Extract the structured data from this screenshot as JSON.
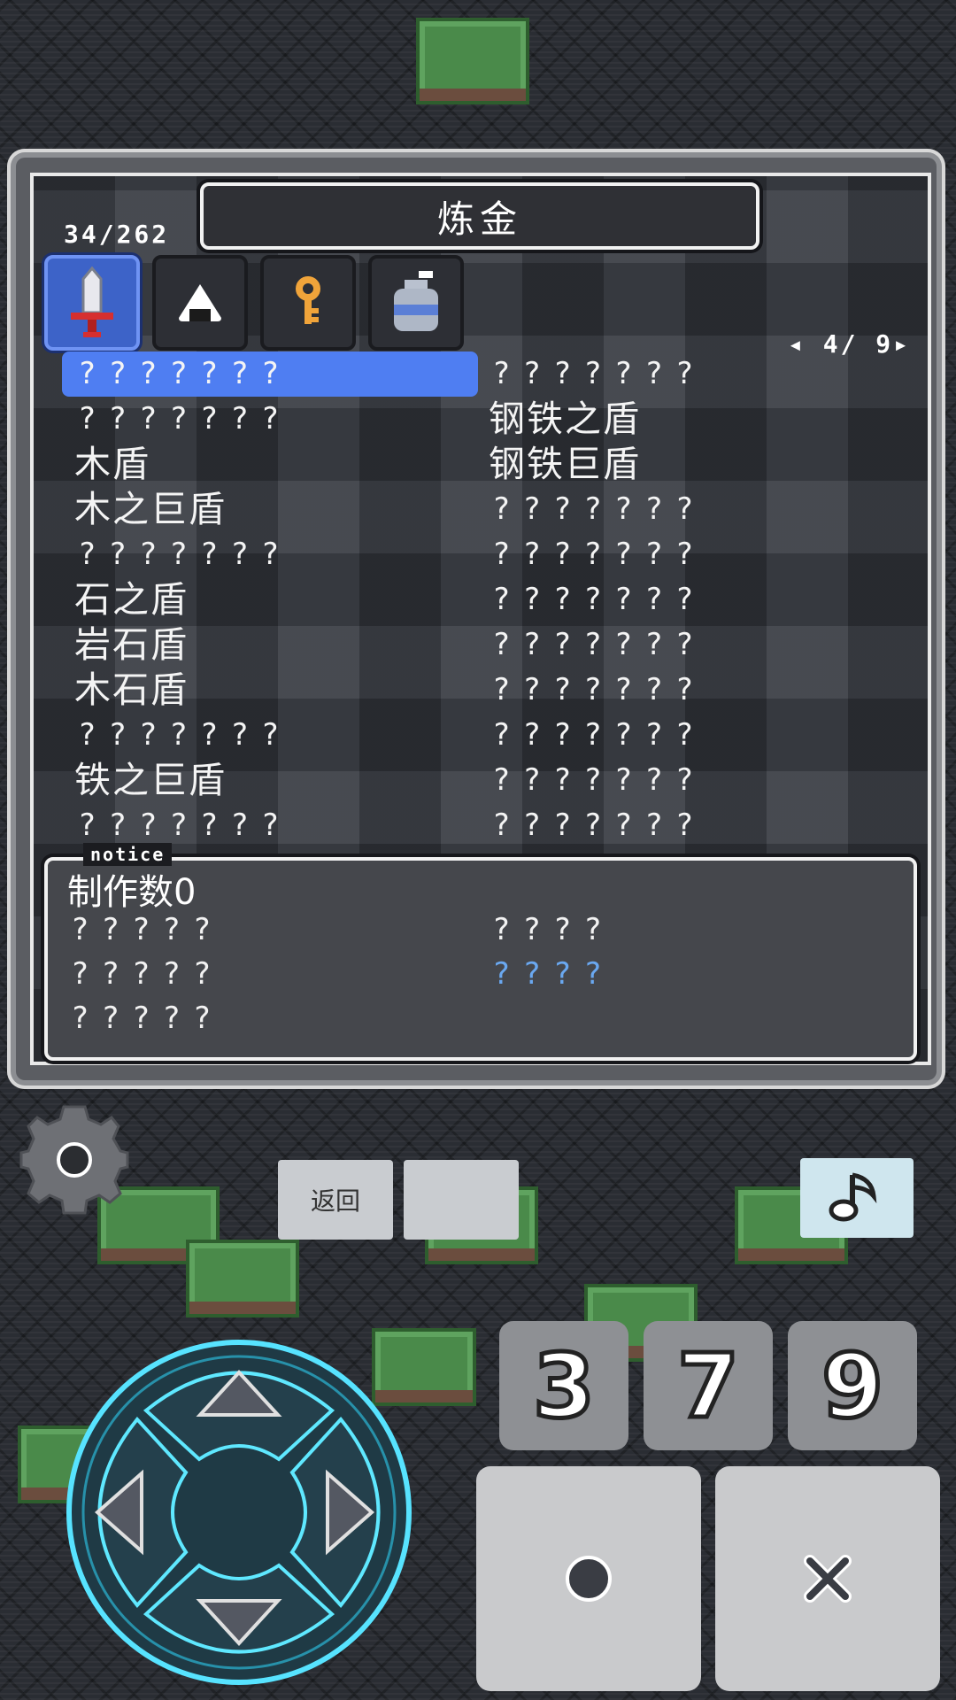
{
  "panel": {
    "title": "炼金",
    "count": "34/262",
    "page_indicator": "◂ 4/ 9▸",
    "tabs": [
      {
        "icon": "sword-icon",
        "active": true
      },
      {
        "icon": "rice-ball-icon",
        "active": false
      },
      {
        "icon": "key-icon",
        "active": false
      },
      {
        "icon": "pot-icon",
        "active": false
      }
    ],
    "items_left": [
      "???????",
      "???????",
      "木盾",
      "木之巨盾",
      "???????",
      "石之盾",
      "岩石盾",
      "木石盾",
      "???????",
      "铁之巨盾",
      "???????"
    ],
    "items_right": [
      "???????",
      "钢铁之盾",
      "钢铁巨盾",
      "???????",
      "???????",
      "???????",
      "???????",
      "???????",
      "???????",
      "???????",
      "???????"
    ]
  },
  "notice": {
    "tag": "notice",
    "made_count": "制作数0",
    "left_lines": [
      "?????",
      "?????",
      "?????"
    ],
    "right_lines": [
      "????",
      "????"
    ]
  },
  "controls": {
    "back_label": "返回",
    "blank_label": "",
    "num_buttons": [
      "3",
      "7",
      "9"
    ],
    "confirm_icon": "circle-icon",
    "cancel_icon": "cross-icon",
    "music_icon": "music-note-icon"
  }
}
